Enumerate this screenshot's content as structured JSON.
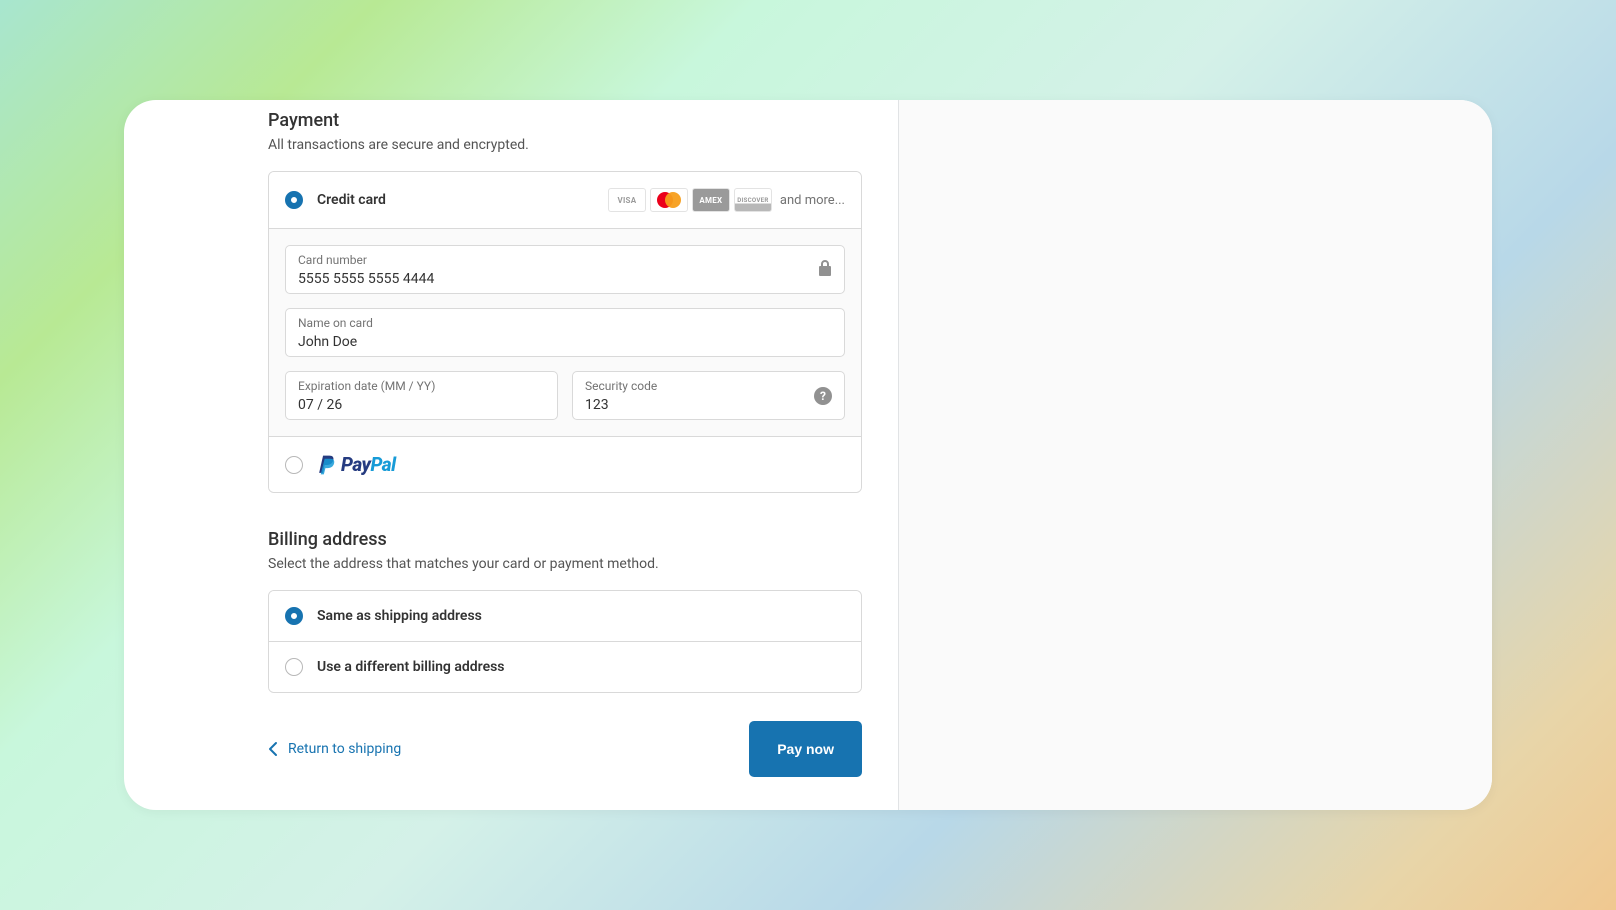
{
  "payment": {
    "title": "Payment",
    "subtitle": "All transactions are secure and encrypted.",
    "credit_card": {
      "label": "Credit card",
      "selected": true,
      "brands": {
        "visa": "VISA",
        "amex": "AMEX",
        "discover": "DISCOVER",
        "more_text": "and more..."
      },
      "card_number": {
        "label": "Card number",
        "value": "5555 5555 5555 4444"
      },
      "name_on_card": {
        "label": "Name on card",
        "value": "John Doe"
      },
      "expiration": {
        "label": "Expiration date (MM / YY)",
        "value": "07 / 26"
      },
      "security": {
        "label": "Security code",
        "value": "123"
      }
    },
    "paypal": {
      "label_a": "Pay",
      "label_b": "Pal",
      "selected": false
    }
  },
  "billing": {
    "title": "Billing address",
    "subtitle": "Select the address that matches your card or payment method.",
    "same": {
      "label": "Same as shipping address",
      "selected": true
    },
    "different": {
      "label": "Use a different billing address",
      "selected": false
    }
  },
  "footer": {
    "return_text": "Return to shipping",
    "pay_button": "Pay now"
  }
}
